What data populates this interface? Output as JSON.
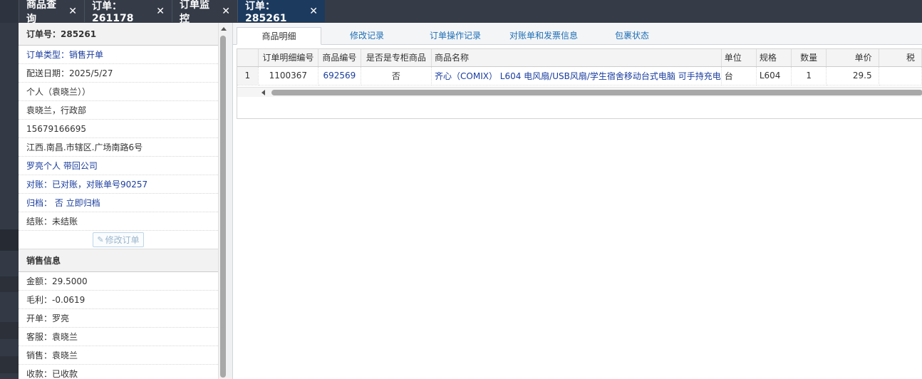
{
  "top_tabs": [
    {
      "label": "商品查询"
    },
    {
      "label": "订单：261178"
    },
    {
      "label": "订单监控"
    },
    {
      "label": "订单：285261"
    }
  ],
  "order_info": {
    "order_no": "订单号：285261",
    "order_type_label": "订单类型：",
    "order_type_value": "销售开单",
    "delivery_date": "配送日期：2025/5/27",
    "customer": "个人（袁晓兰））",
    "contact": "袁晓兰，行政部",
    "phone": "15679166695",
    "address": "江西.南昌.市辖区.广场南路6号",
    "shipper": "罗亮个人 带回公司",
    "reconcile_label": "对账：",
    "reconcile_value": "已对账，对账单号90257",
    "archive_label": "归档：",
    "archive_value": " 否 立即归档",
    "settle": "结账：未结账",
    "edit_button": "修改订单"
  },
  "sales_info": {
    "heading": "销售信息",
    "amount": "金额：29.5000",
    "gross_profit": "毛利：-0.0619",
    "opened_by": "开单：罗亮",
    "service": "客服：袁晓兰",
    "sales": "销售：袁晓兰",
    "payment": "收款：已收款"
  },
  "sub_tabs": [
    {
      "label": "商品明细",
      "active": true
    },
    {
      "label": "修改记录"
    },
    {
      "label": "订单操作记录"
    },
    {
      "label": "对账单和发票信息"
    },
    {
      "label": "包裹状态"
    }
  ],
  "grid": {
    "columns": [
      "订单明细编号",
      "商品编号",
      "是否是专柜商品",
      "商品名称",
      "单位",
      "规格",
      "数量",
      "单价",
      "税"
    ],
    "rows": [
      {
        "row_no": "1",
        "detail_id": "1100367",
        "product_id": "692569",
        "is_counter": "否",
        "name": "齐心（COMIX） L604 电风扇/USB风扇/学生宿舍移动台式电脑 可手持充电",
        "unit": "台",
        "spec": "L604",
        "qty": "1",
        "price": "29.5"
      }
    ]
  },
  "colors": {
    "active_top_tab": "#1c3a5e",
    "link_blue": "#1a3d9e",
    "subtab_blue": "#1e6fb5"
  }
}
